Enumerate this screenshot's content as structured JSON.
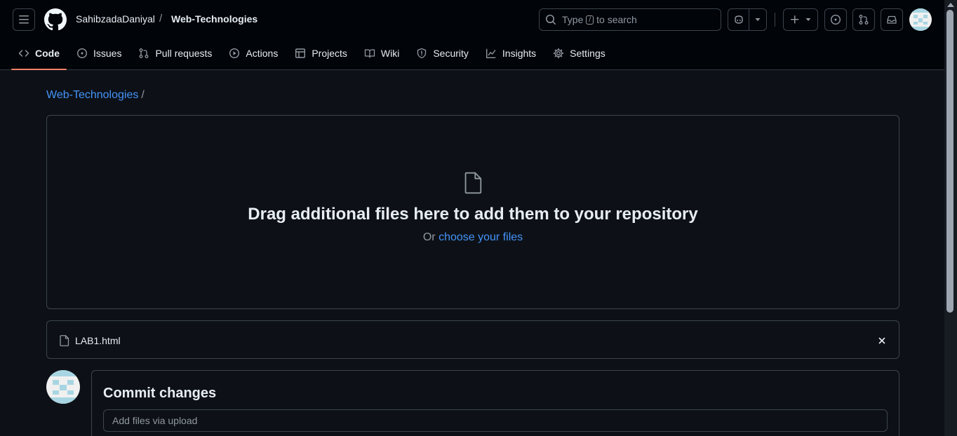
{
  "header": {
    "menu_icon": "three-bars-icon",
    "logo_icon": "github-mark-icon",
    "owner": "SahibzadaDaniyal",
    "separator": "/",
    "repo": "Web-Technologies",
    "search": {
      "prefix": "Type",
      "key": "/",
      "suffix": "to search"
    },
    "actions": [
      "copilot-icon",
      "triangle-down-icon",
      "plus-icon",
      "issue-opened-icon",
      "git-pull-request-icon",
      "inbox-icon"
    ]
  },
  "tabs": [
    {
      "label": "Code",
      "icon": "code-icon",
      "selected": true
    },
    {
      "label": "Issues",
      "icon": "issue-opened-icon"
    },
    {
      "label": "Pull requests",
      "icon": "git-pull-request-icon"
    },
    {
      "label": "Actions",
      "icon": "play-icon"
    },
    {
      "label": "Projects",
      "icon": "table-icon"
    },
    {
      "label": "Wiki",
      "icon": "book-icon"
    },
    {
      "label": "Security",
      "icon": "shield-icon"
    },
    {
      "label": "Insights",
      "icon": "graph-icon"
    },
    {
      "label": "Settings",
      "icon": "gear-icon"
    }
  ],
  "breadcrumb": {
    "repo": "Web-Technologies",
    "separator": "/"
  },
  "dropzone": {
    "icon": "file-icon",
    "title": "Drag additional files here to add them to your repository",
    "or_text": "Or",
    "choose_link": "choose your files"
  },
  "files": [
    {
      "name": "LAB1.html",
      "icon": "file-icon",
      "remove_icon": "x-icon"
    }
  ],
  "commit": {
    "title": "Commit changes",
    "placeholder": "Add files via upload"
  },
  "colors": {
    "background": "#0d1117",
    "header_background": "#010409",
    "accent_link": "#4493f8",
    "selected_tab_underline": "#f78166",
    "border": "#3d444d"
  }
}
